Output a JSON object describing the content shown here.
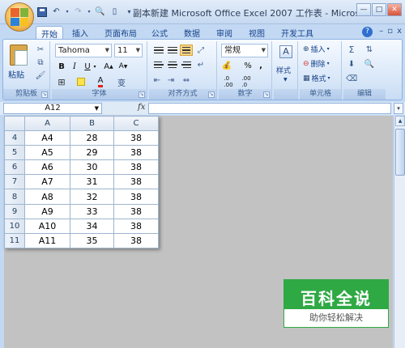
{
  "window": {
    "title": "副本新建 Microsoft Office Excel 2007 工作表 - Micros..."
  },
  "tabs": [
    "开始",
    "插入",
    "页面布局",
    "公式",
    "数据",
    "审阅",
    "视图",
    "开发工具"
  ],
  "ribbon": {
    "clipboard": {
      "paste_label": "粘贴",
      "group_label": "剪贴板"
    },
    "font": {
      "font_name": "Tahoma",
      "font_size": "11",
      "bold": "B",
      "italic": "I",
      "underline": "U",
      "font_color_glyph": "A",
      "phonetic": "变",
      "group_label": "字体"
    },
    "alignment": {
      "group_label": "对齐方式"
    },
    "number": {
      "format": "常规",
      "percent": "%",
      "comma": ",",
      "group_label": "数字"
    },
    "styles": {
      "label": "样式"
    },
    "cells": {
      "insert": "插入",
      "delete": "删除",
      "format": "格式",
      "group_label": "单元格"
    },
    "editing": {
      "group_label": "编辑"
    }
  },
  "formula_bar": {
    "name_box": "A12",
    "fx": "fx",
    "formula": ""
  },
  "sheet": {
    "columns": [
      "A",
      "B",
      "C"
    ],
    "rows": [
      {
        "row": "4",
        "a": "A4",
        "b": "28",
        "c": "38"
      },
      {
        "row": "5",
        "a": "A5",
        "b": "29",
        "c": "38"
      },
      {
        "row": "6",
        "a": "A6",
        "b": "30",
        "c": "38"
      },
      {
        "row": "7",
        "a": "A7",
        "b": "31",
        "c": "38"
      },
      {
        "row": "8",
        "a": "A8",
        "b": "32",
        "c": "38"
      },
      {
        "row": "9",
        "a": "A9",
        "b": "33",
        "c": "38"
      },
      {
        "row": "10",
        "a": "A10",
        "b": "34",
        "c": "38"
      },
      {
        "row": "11",
        "a": "A11",
        "b": "35",
        "c": "38"
      }
    ]
  },
  "watermark": {
    "title": "百科全说",
    "subtitle": "助你轻松解决"
  },
  "colors": {
    "ribbon_bg": "#dbe7f7",
    "tab_text": "#15428b",
    "sheet_bg": "#c2c2c2",
    "watermark_green": "#2fa944"
  }
}
